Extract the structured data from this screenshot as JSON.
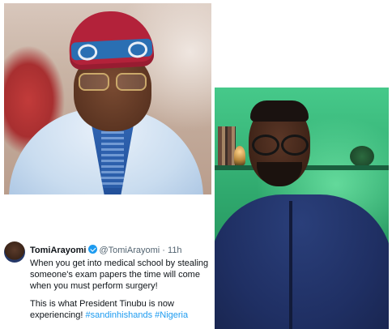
{
  "images": {
    "top_left_photo": "man-in-red-cap-portrait",
    "right_photo": "man-with-glasses-speaking-video"
  },
  "tweet": {
    "display_name": "TomiArayomi",
    "handle": "@TomiArayomi",
    "separator": "·",
    "time": "11h",
    "verified_icon": "verified-badge-icon",
    "paragraph_1": "When you get into medical school by stealing someone's exam papers the time will come when you must perform surgery!",
    "paragraph_2_text": "This is what President Tinubu is now experiencing!",
    "hashtags": [
      "#sandinhishands",
      "#Nigeria"
    ]
  },
  "colors": {
    "link_blue": "#1d9bf0",
    "green_backdrop": "#2fa86d",
    "text": "#0f1419",
    "muted": "#536471"
  }
}
